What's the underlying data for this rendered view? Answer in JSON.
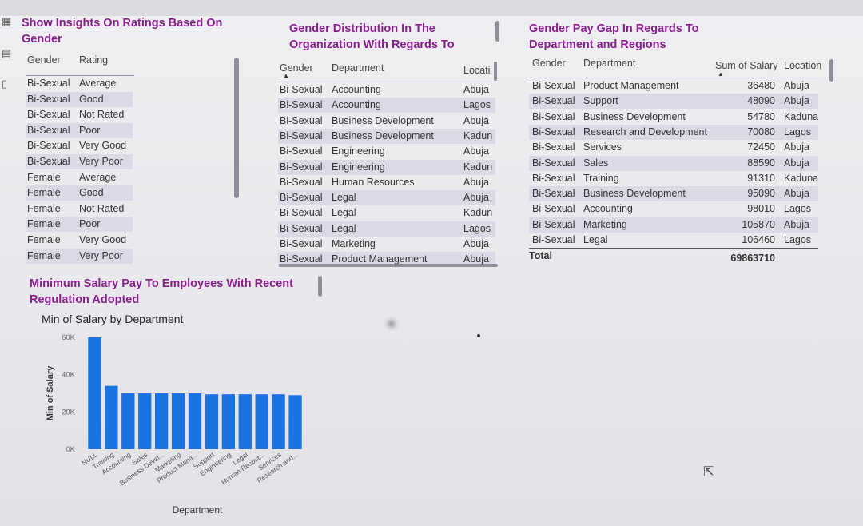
{
  "visuals": {
    "ratings": {
      "title_line1": "Show Insights On Ratings Based On",
      "title_line2": "Gender",
      "columns": [
        "Gender",
        "Rating"
      ],
      "rows": [
        [
          "Bi-Sexual",
          "Average"
        ],
        [
          "Bi-Sexual",
          "Good"
        ],
        [
          "Bi-Sexual",
          "Not Rated"
        ],
        [
          "Bi-Sexual",
          "Poor"
        ],
        [
          "Bi-Sexual",
          "Very Good"
        ],
        [
          "Bi-Sexual",
          "Very Poor"
        ],
        [
          "Female",
          "Average"
        ],
        [
          "Female",
          "Good"
        ],
        [
          "Female",
          "Not Rated"
        ],
        [
          "Female",
          "Poor"
        ],
        [
          "Female",
          "Very Good"
        ],
        [
          "Female",
          "Very Poor"
        ]
      ]
    },
    "distribution": {
      "title_line1": "Gender Distribution In The",
      "title_line2": "Organization With Regards To",
      "columns": [
        "Gender",
        "Department",
        "Locati"
      ],
      "rows": [
        [
          "Bi-Sexual",
          "Accounting",
          "Abuja"
        ],
        [
          "Bi-Sexual",
          "Accounting",
          "Lagos"
        ],
        [
          "Bi-Sexual",
          "Business Development",
          "Abuja"
        ],
        [
          "Bi-Sexual",
          "Business Development",
          "Kadun"
        ],
        [
          "Bi-Sexual",
          "Engineering",
          "Abuja"
        ],
        [
          "Bi-Sexual",
          "Engineering",
          "Kadun"
        ],
        [
          "Bi-Sexual",
          "Human Resources",
          "Abuja"
        ],
        [
          "Bi-Sexual",
          "Legal",
          "Abuja"
        ],
        [
          "Bi-Sexual",
          "Legal",
          "Kadun"
        ],
        [
          "Bi-Sexual",
          "Legal",
          "Lagos"
        ],
        [
          "Bi-Sexual",
          "Marketing",
          "Abuja"
        ],
        [
          "Bi-Sexual",
          "Product Management",
          "Abuja"
        ]
      ]
    },
    "paygap": {
      "title_line1": "Gender Pay Gap In Regards To",
      "title_line2": "Department and Regions",
      "columns": [
        "Gender",
        "Department",
        "Sum of Salary",
        "Location"
      ],
      "rows": [
        [
          "Bi-Sexual",
          "Product Management",
          "36480",
          "Abuja"
        ],
        [
          "Bi-Sexual",
          "Support",
          "48090",
          "Abuja"
        ],
        [
          "Bi-Sexual",
          "Business Development",
          "54780",
          "Kaduna"
        ],
        [
          "Bi-Sexual",
          "Research and Development",
          "70080",
          "Lagos"
        ],
        [
          "Bi-Sexual",
          "Services",
          "72450",
          "Abuja"
        ],
        [
          "Bi-Sexual",
          "Sales",
          "88590",
          "Abuja"
        ],
        [
          "Bi-Sexual",
          "Training",
          "91310",
          "Kaduna"
        ],
        [
          "Bi-Sexual",
          "Business Development",
          "95090",
          "Abuja"
        ],
        [
          "Bi-Sexual",
          "Accounting",
          "98010",
          "Lagos"
        ],
        [
          "Bi-Sexual",
          "Marketing",
          "105870",
          "Abuja"
        ],
        [
          "Bi-Sexual",
          "Legal",
          "106460",
          "Lagos"
        ]
      ],
      "total_label": "Total",
      "total_value": "69863710"
    },
    "min_salary": {
      "title_line1": "Minimum Salary Pay To Employees With Recent",
      "title_line2": "Regulation Adopted"
    }
  },
  "chart_data": {
    "type": "bar",
    "title": "Min of Salary by Department",
    "xlabel": "Department",
    "ylabel": "Min of Salary",
    "ylim": [
      0,
      60000
    ],
    "yticks": [
      "0K",
      "20K",
      "40K",
      "60K"
    ],
    "ytick_values": [
      0,
      20000,
      40000,
      60000
    ],
    "categories": [
      "NULL",
      "Training",
      "Accounting",
      "Sales",
      "Business Devel...",
      "Marketing",
      "Product Mana...",
      "Support",
      "Engineering",
      "Legal",
      "Human Resour...",
      "Services",
      "Research and..."
    ],
    "values": [
      60000,
      34000,
      30000,
      30000,
      30000,
      30000,
      30000,
      29500,
      29500,
      29500,
      29500,
      29500,
      29000
    ],
    "bar_color": "#1a73e0",
    "grid": false,
    "legend": "none"
  },
  "colors": {
    "title": "#8a1e8f",
    "row_alt": "#d9dae6",
    "bar": "#1a73e0"
  }
}
